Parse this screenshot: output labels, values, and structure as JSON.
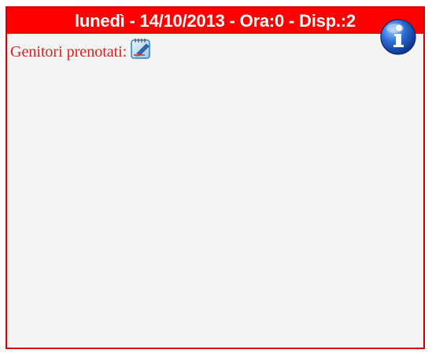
{
  "header": {
    "title": "lunedì - 14/10/2013 - Ora:0 - Disp.:2"
  },
  "content": {
    "label": "Genitori prenotati:"
  },
  "icons": {
    "edit": "edit-note-icon",
    "info": "info-icon"
  },
  "colors": {
    "header_bg": "#ff0000",
    "border": "#d60000",
    "label": "#e02020",
    "panel_bg": "#f4f4f4"
  }
}
